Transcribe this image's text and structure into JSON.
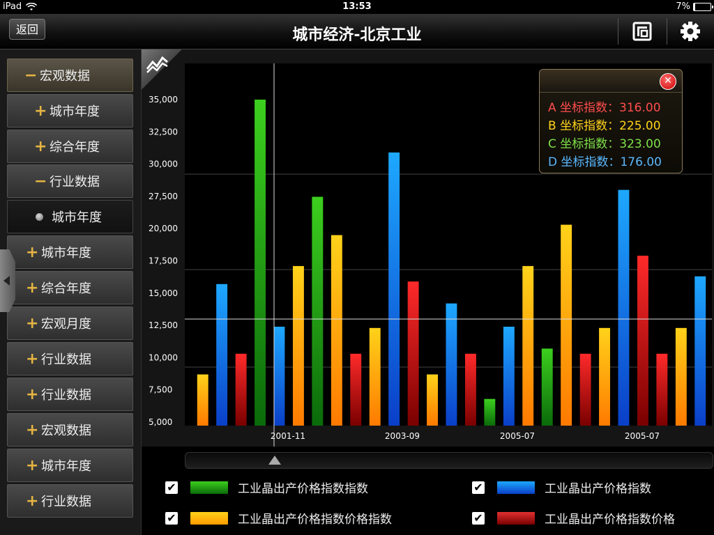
{
  "status": {
    "device": "iPad",
    "time": "13:53",
    "battery": "7%"
  },
  "nav": {
    "back_label": "返回",
    "title": "城市经济-北京工业"
  },
  "sidebar": {
    "items": [
      {
        "label": "宏观数据",
        "mark": "−"
      },
      {
        "label": "城市年度",
        "mark": "+"
      },
      {
        "label": "综合年度",
        "mark": "+"
      },
      {
        "label": "行业数据",
        "mark": "−"
      },
      {
        "label": "城市年度",
        "mark": "•"
      },
      {
        "label": "城市年度",
        "mark": "+"
      },
      {
        "label": "综合年度",
        "mark": "+"
      },
      {
        "label": "宏观月度",
        "mark": "+"
      },
      {
        "label": "行业数据",
        "mark": "+"
      },
      {
        "label": "行业数据",
        "mark": "+"
      },
      {
        "label": "宏观数据",
        "mark": "+"
      },
      {
        "label": "城市年度",
        "mark": "+"
      },
      {
        "label": "行业数据",
        "mark": "+"
      }
    ]
  },
  "tooltip": {
    "rows": [
      {
        "label": "A 坐标指数：316.00",
        "color": "#ff4d4d"
      },
      {
        "label": "B 坐标指数：225.00",
        "color": "#ffd21a"
      },
      {
        "label": "C 坐标指数：323.00",
        "color": "#7de04a"
      },
      {
        "label": "D 坐标指数：176.00",
        "color": "#5ab8ff"
      }
    ]
  },
  "chart_data": {
    "type": "bar",
    "yticks": [
      "35,000",
      "32,500",
      "30,000",
      "27,500",
      "20,000",
      "17,500",
      "15,000",
      "12,500",
      "10,000",
      "7,500",
      "5,000"
    ],
    "xticks": [
      "2001-11",
      "2003-09",
      "2005-07",
      "2005-07"
    ],
    "series_colors": {
      "orange": [
        "#ffd21a",
        "#ff7a00"
      ],
      "blue": [
        "#1ea8ff",
        "#0a3fc8"
      ],
      "red": [
        "#ff2a2a",
        "#7a0000"
      ],
      "green": [
        "#3ccf1e",
        "#0a6a0a"
      ]
    },
    "bars": [
      {
        "value": 8700,
        "color": "orange"
      },
      {
        "value": 15700,
        "color": "blue"
      },
      {
        "value": 10300,
        "color": "red"
      },
      {
        "value": 35200,
        "color": "green"
      },
      {
        "value": 12400,
        "color": "blue"
      },
      {
        "value": 17100,
        "color": "orange"
      },
      {
        "value": 27400,
        "color": "green"
      },
      {
        "value": 19500,
        "color": "orange"
      },
      {
        "value": 10300,
        "color": "red"
      },
      {
        "value": 12300,
        "color": "orange"
      },
      {
        "value": 30900,
        "color": "blue"
      },
      {
        "value": 15900,
        "color": "red"
      },
      {
        "value": 8700,
        "color": "orange"
      },
      {
        "value": 14200,
        "color": "blue"
      },
      {
        "value": 10300,
        "color": "red"
      },
      {
        "value": 6800,
        "color": "green"
      },
      {
        "value": 12400,
        "color": "blue"
      },
      {
        "value": 17100,
        "color": "orange"
      },
      {
        "value": 10700,
        "color": "green"
      },
      {
        "value": 20900,
        "color": "orange"
      },
      {
        "value": 10300,
        "color": "red"
      },
      {
        "value": 12300,
        "color": "orange"
      },
      {
        "value": 28000,
        "color": "blue"
      },
      {
        "value": 17900,
        "color": "red"
      },
      {
        "value": 10300,
        "color": "red"
      },
      {
        "value": 12300,
        "color": "orange"
      },
      {
        "value": 16300,
        "color": "blue"
      }
    ]
  },
  "legend": [
    {
      "label": "工业晶出产价格指数指数",
      "checked": "✔",
      "color": "green"
    },
    {
      "label": "工业晶出产价格指数",
      "checked": "✔",
      "color": "blue"
    },
    {
      "label": "工业晶出产价格指数价格指数",
      "checked": "✔",
      "color": "orange"
    },
    {
      "label": "工业晶出产价格指数价格",
      "checked": "✔",
      "color": "red"
    }
  ]
}
